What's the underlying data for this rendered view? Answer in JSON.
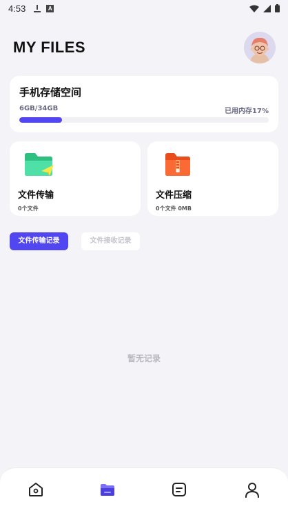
{
  "status_bar": {
    "time": "4:53"
  },
  "header": {
    "title": "MY FILES"
  },
  "storage": {
    "title": "手机存储空间",
    "used_label": "6GB/34GB",
    "percent_label": "已用内存17%",
    "progress_fraction": 0.17,
    "accent_color": "#5146f0"
  },
  "tools": [
    {
      "title": "文件传输",
      "subtitle": "0个文件",
      "icon": "green-folder-send-icon",
      "color": "#3ecf94"
    },
    {
      "title": "文件压缩",
      "subtitle": "0个文件   0MB",
      "icon": "orange-zip-folder-icon",
      "color": "#fb6630"
    }
  ],
  "tabs": {
    "active": "文件传输记录",
    "inactive": "文件接收记录"
  },
  "empty_state": "暂无记录",
  "bottom_nav": [
    {
      "name": "home-icon"
    },
    {
      "name": "folder-icon",
      "active": true
    },
    {
      "name": "document-icon"
    },
    {
      "name": "profile-icon"
    }
  ]
}
